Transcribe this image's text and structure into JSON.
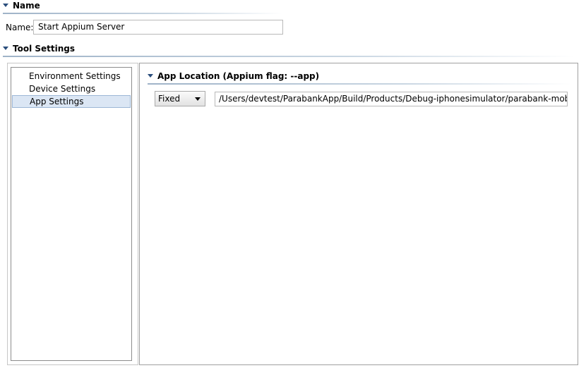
{
  "sections": {
    "name": {
      "title": "Name"
    },
    "tool_settings": {
      "title": "Tool Settings"
    }
  },
  "name_field": {
    "label": "Name:",
    "value": "Start Appium Server"
  },
  "tree": {
    "items": [
      {
        "label": "Environment Settings"
      },
      {
        "label": "Device Settings"
      },
      {
        "label": "App Settings"
      }
    ]
  },
  "app_location": {
    "title": "App Location (Appium flag: --app)",
    "mode": "Fixed",
    "path": "/Users/devtest/ParabankApp/Build/Products/Debug-iphonesimulator/parabank-mobile.app"
  },
  "colors": {
    "header_rule": "#9fb3c8",
    "triangle": "#2a4d7c",
    "selected_bg": "#dbe6f4",
    "selected_border": "#9cb6d6"
  }
}
